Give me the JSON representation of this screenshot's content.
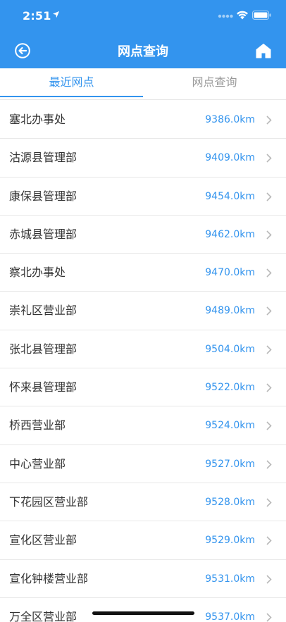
{
  "status_bar": {
    "time": "2:51"
  },
  "nav": {
    "title": "网点查询"
  },
  "tabs": [
    {
      "label": "最近网点",
      "active": true
    },
    {
      "label": "网点查询",
      "active": false
    }
  ],
  "branches": [
    {
      "name": "塞北办事处",
      "distance": "9386.0km"
    },
    {
      "name": "沽源县管理部",
      "distance": "9409.0km"
    },
    {
      "name": "康保县管理部",
      "distance": "9454.0km"
    },
    {
      "name": "赤城县管理部",
      "distance": "9462.0km"
    },
    {
      "name": "察北办事处",
      "distance": "9470.0km"
    },
    {
      "name": "崇礼区营业部",
      "distance": "9489.0km"
    },
    {
      "name": "张北县管理部",
      "distance": "9504.0km"
    },
    {
      "name": "怀来县管理部",
      "distance": "9522.0km"
    },
    {
      "name": "桥西营业部",
      "distance": "9524.0km"
    },
    {
      "name": "中心营业部",
      "distance": "9527.0km"
    },
    {
      "name": "下花园区营业部",
      "distance": "9528.0km"
    },
    {
      "name": "宣化区营业部",
      "distance": "9529.0km"
    },
    {
      "name": "宣化钟楼营业部",
      "distance": "9531.0km"
    },
    {
      "name": "万全区营业部",
      "distance": "9537.0km"
    }
  ],
  "colors": {
    "accent": "#3394ee",
    "text": "#333333",
    "muted": "#999999"
  }
}
